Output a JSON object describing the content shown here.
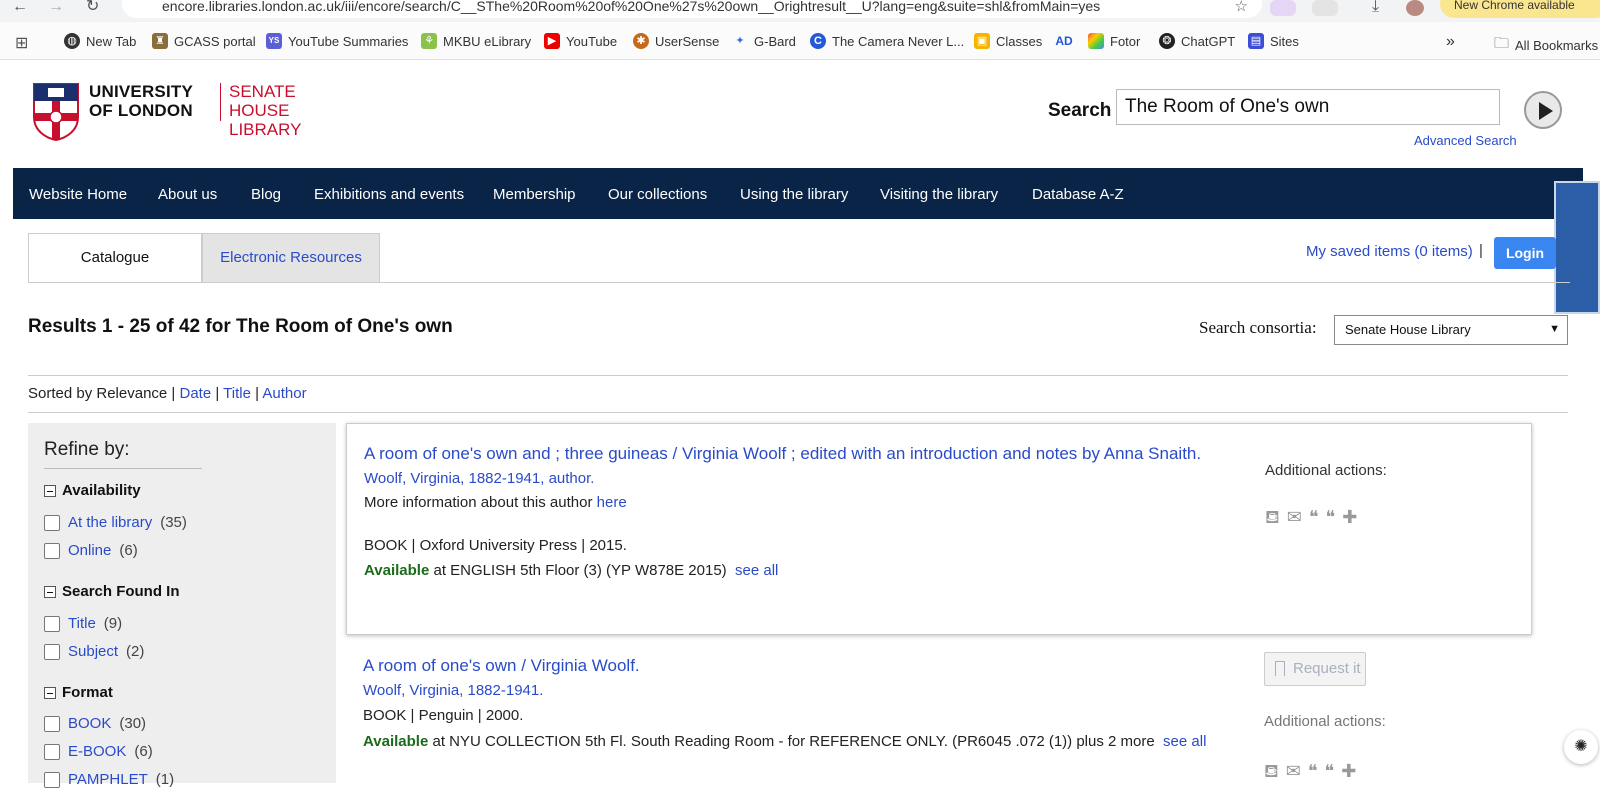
{
  "browser": {
    "url": "encore.libraries.london.ac.uk/iii/encore/search/C__SThe%20Room%20of%20One%27s%20own__Orightresult__U?lang=eng&suite=shl&fromMain=yes",
    "update_label": "New Chrome available",
    "bookmarks": [
      {
        "label": "New Tab",
        "icon": "globe-icon"
      },
      {
        "label": "GCASS portal",
        "icon": "gcass-icon"
      },
      {
        "label": "YouTube Summaries",
        "icon": "ys-icon"
      },
      {
        "label": "MKBU eLibrary",
        "icon": "elibrary-icon"
      },
      {
        "label": "YouTube",
        "icon": "youtube-icon"
      },
      {
        "label": "UserSense",
        "icon": "usersense-icon"
      },
      {
        "label": "G-Bard",
        "icon": "bard-icon"
      },
      {
        "label": "The Camera Never L...",
        "icon": "camera-icon"
      },
      {
        "label": "Classes",
        "icon": "classes-icon"
      },
      {
        "label": "",
        "icon": "ad-icon"
      },
      {
        "label": "Fotor",
        "icon": "fotor-icon"
      },
      {
        "label": "ChatGPT",
        "icon": "chatgpt-icon"
      },
      {
        "label": "Sites",
        "icon": "sites-icon"
      }
    ],
    "ad_badge": "AD",
    "ys_badge": "YS",
    "more": "»",
    "all_bookmarks": "All Bookmarks"
  },
  "header": {
    "logo_line1": "UNIVERSITY",
    "logo_line2": "OF LONDON",
    "logo_shl1": "SENATE HOUSE",
    "logo_shl2": "LIBRARY",
    "search_label": "Search",
    "search_value": "The Room of One's own",
    "advanced_search": "Advanced Search"
  },
  "nav": [
    "Website Home",
    "About us",
    "Blog",
    "Exhibitions and events",
    "Membership",
    "Our collections",
    "Using the library",
    "Visiting the library",
    "Database A-Z"
  ],
  "tabs": {
    "catalogue": "Catalogue",
    "electronic": "Electronic Resources"
  },
  "account": {
    "saved_items": "My saved items (0 items)",
    "separator": "|",
    "login": "Login"
  },
  "results": {
    "summary": "Results 1 - 25 of 42 for The Room of One's own",
    "consortia_label": "Search consortia:",
    "consortia_value": "Senate House Library"
  },
  "sort": {
    "prefix": "Sorted by  Relevance",
    "sep": "|",
    "date": "Date",
    "title": "Title",
    "author": "Author"
  },
  "refine": {
    "title": "Refine by:",
    "facets": [
      {
        "heading": "Availability",
        "items": [
          {
            "label": "At the library",
            "count": "(35)"
          },
          {
            "label": "Online",
            "count": "(6)"
          }
        ]
      },
      {
        "heading": "Search Found In",
        "items": [
          {
            "label": "Title",
            "count": "(9)"
          },
          {
            "label": "Subject",
            "count": "(2)"
          }
        ]
      },
      {
        "heading": "Format",
        "items": [
          {
            "label": "BOOK",
            "count": "(30)"
          },
          {
            "label": "E-BOOK",
            "count": "(6)"
          },
          {
            "label": "PAMPHLET",
            "count": "(1)"
          }
        ]
      }
    ]
  },
  "records": [
    {
      "title": "A room of one's own and ; three guineas / Virginia Woolf ; edited with an introduction and notes by Anna Snaith.",
      "author": "Woolf, Virginia, 1882-1941, author.",
      "more_info": "More information about this author",
      "more_link": "here",
      "format_line": "BOOK  |  Oxford University Press  |  2015.",
      "available": "Available",
      "location": " at ENGLISH 5th Floor (3) (YP W878E 2015)",
      "see_all": "see all",
      "actions_label": "Additional actions:"
    },
    {
      "title": "A room of one's own / Virginia Woolf.",
      "author": "Woolf, Virginia, 1882-1941.",
      "format_line": "BOOK  |  Penguin  |  2000.",
      "available": "Available",
      "location": " at NYU COLLECTION 5th Fl. South Reading Room - for REFERENCE ONLY. (PR6045 .072 (1)) plus 2 more",
      "see_all": "see all",
      "request": "Request it",
      "actions_label": "Additional actions:"
    }
  ],
  "colors": {
    "nav_bg": "#0a2447",
    "link": "#2a4bc9",
    "available": "#1c6b1c",
    "brand_red": "#c8102e",
    "login": "#3a86f0"
  }
}
